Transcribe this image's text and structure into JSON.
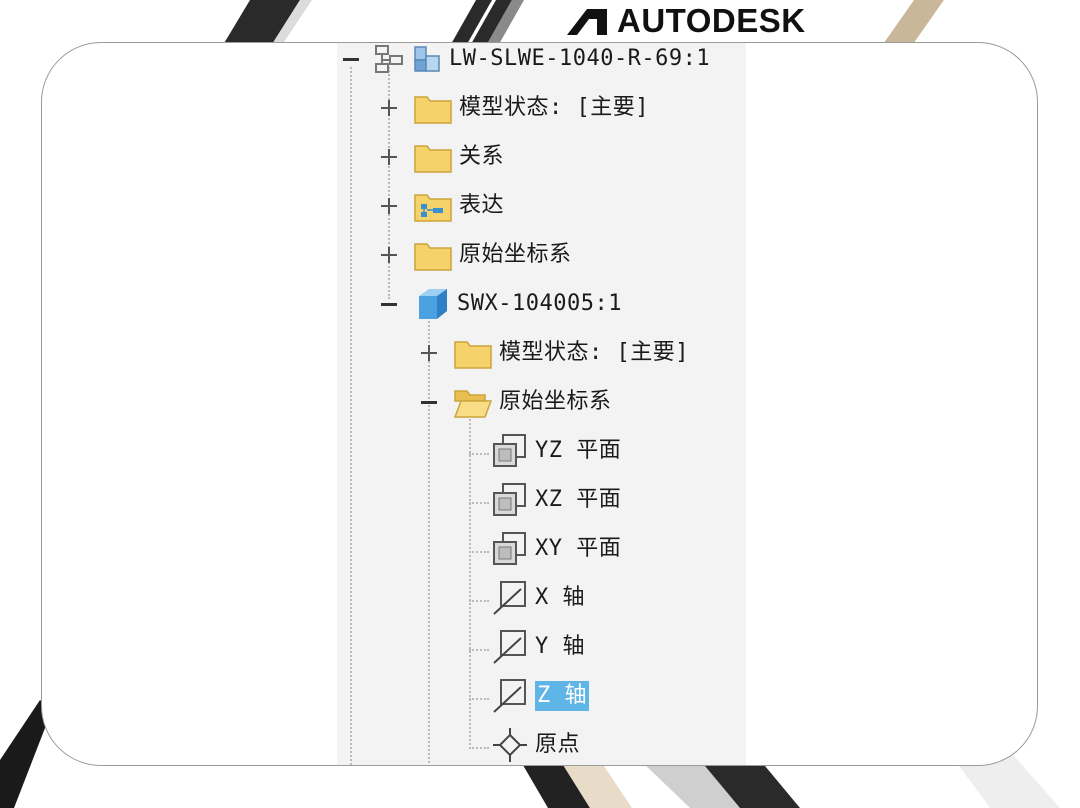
{
  "brand": {
    "name": "AUTODESK"
  },
  "tree": {
    "root": {
      "label": "LW-SLWE-1040-R-69:1",
      "icon": "assembly-icon",
      "expanded": true
    },
    "root_children": [
      {
        "label": "模型状态: [主要]",
        "icon": "folder-icon",
        "expanded": false
      },
      {
        "label": "关系",
        "icon": "folder-icon",
        "expanded": false
      },
      {
        "label": "表达",
        "icon": "representation-folder-icon",
        "expanded": false
      },
      {
        "label": "原始坐标系",
        "icon": "folder-icon",
        "expanded": false
      }
    ],
    "part": {
      "label": "SWX-104005:1",
      "icon": "part-cube-icon",
      "expanded": true
    },
    "part_children": [
      {
        "label": "模型状态: [主要]",
        "icon": "folder-icon",
        "expanded": false
      },
      {
        "label": "原始坐标系",
        "icon": "folder-open-icon",
        "expanded": true
      }
    ],
    "origin_items": [
      {
        "label": "YZ 平面",
        "icon": "work-plane-icon"
      },
      {
        "label": "XZ 平面",
        "icon": "work-plane-icon"
      },
      {
        "label": "XY 平面",
        "icon": "work-plane-icon"
      },
      {
        "label": "X 轴",
        "icon": "work-axis-icon"
      },
      {
        "label": "Y 轴",
        "icon": "work-axis-icon"
      },
      {
        "label": "Z 轴",
        "icon": "work-axis-icon",
        "selected": true
      },
      {
        "label": "原点",
        "icon": "work-point-icon"
      }
    ]
  },
  "colors": {
    "panel_bg": "#f3f3f3",
    "selection": "#5fb5e6",
    "folder": "#f5d36a",
    "part": "#4aa3e0"
  }
}
